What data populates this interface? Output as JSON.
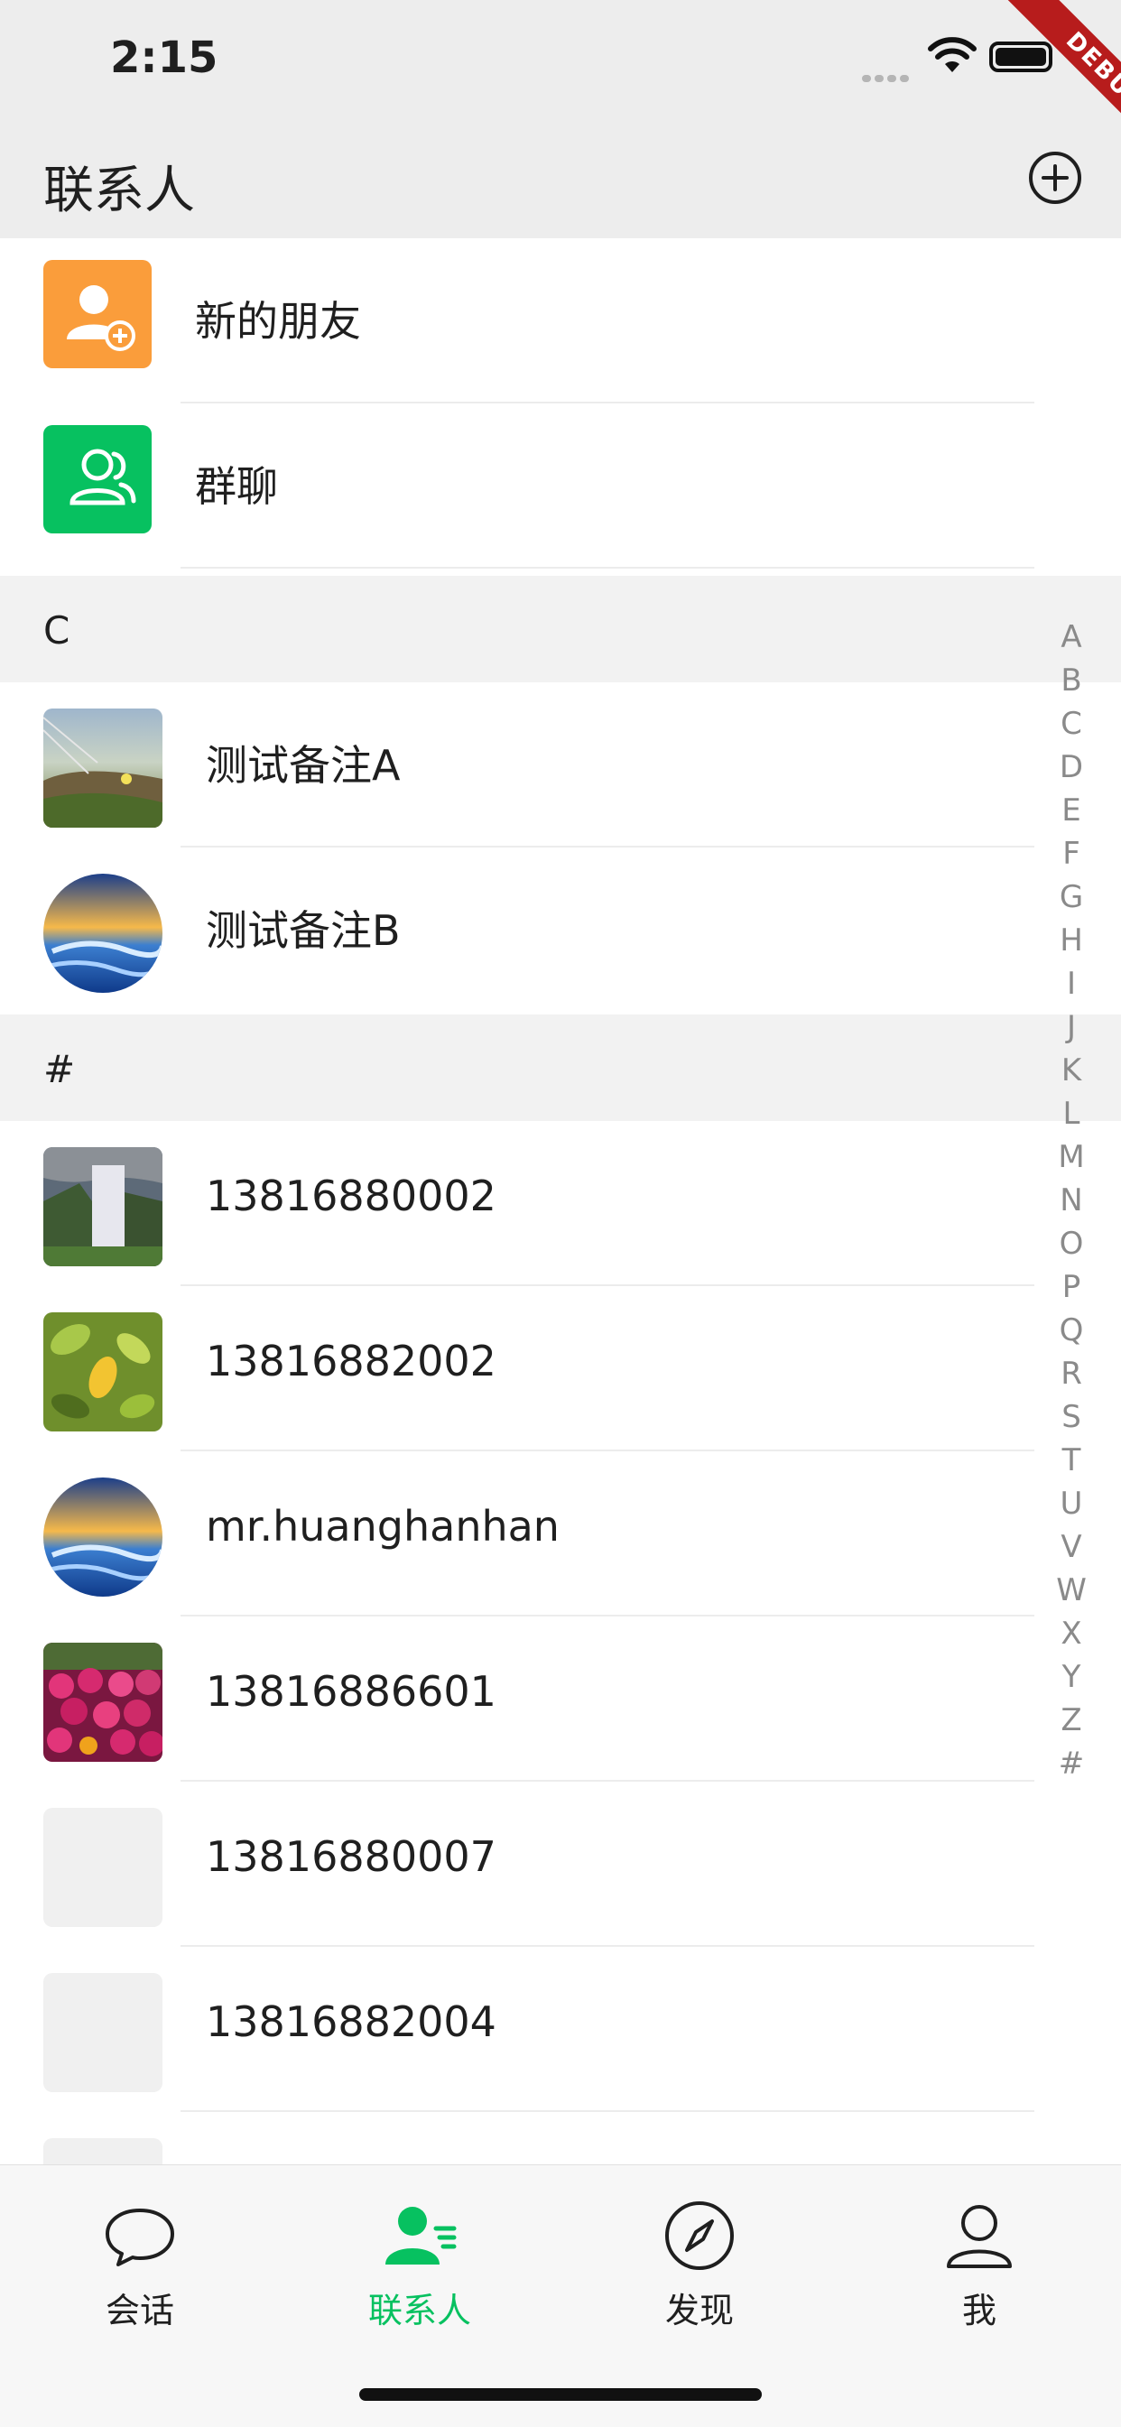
{
  "status_bar": {
    "time": "2:15",
    "debug_label": "DEBUG"
  },
  "nav": {
    "title": "联系人",
    "add_icon": "plus-circle-icon"
  },
  "top_items": [
    {
      "label": "新的朋友",
      "icon": "add-friend-icon",
      "color": "#fa9d3b"
    },
    {
      "label": "群聊",
      "icon": "group-chat-icon",
      "color": "#07c160"
    }
  ],
  "sections": [
    {
      "letter": "C",
      "contacts": [
        {
          "name": "测试备注A",
          "avatar": "meadow-photo"
        },
        {
          "name": "测试备注B",
          "avatar": "sunset-sea-photo"
        }
      ]
    },
    {
      "letter": "#",
      "contacts": [
        {
          "name": "13816880002",
          "avatar": "waterfall-photo"
        },
        {
          "name": "13816882002",
          "avatar": "leaves-photo"
        },
        {
          "name": "mr.huanghanhan",
          "avatar": "sunset-sea-photo"
        },
        {
          "name": "13816886601",
          "avatar": "flowers-photo"
        },
        {
          "name": "13816880007",
          "avatar": "placeholder"
        },
        {
          "name": "13816882004",
          "avatar": "placeholder"
        }
      ]
    }
  ],
  "index_letters": [
    "A",
    "B",
    "C",
    "D",
    "E",
    "F",
    "G",
    "H",
    "I",
    "J",
    "K",
    "L",
    "M",
    "N",
    "O",
    "P",
    "Q",
    "R",
    "S",
    "T",
    "U",
    "V",
    "W",
    "X",
    "Y",
    "Z",
    "#"
  ],
  "tabs": [
    {
      "label": "会话",
      "icon": "chat-bubble-icon",
      "active": false
    },
    {
      "label": "联系人",
      "icon": "contacts-icon",
      "active": true
    },
    {
      "label": "发现",
      "icon": "compass-icon",
      "active": false
    },
    {
      "label": "我",
      "icon": "person-icon",
      "active": false
    }
  ],
  "colors": {
    "accent": "#07c160",
    "header_bg": "#ededed",
    "section_bg": "#f2f2f2"
  }
}
